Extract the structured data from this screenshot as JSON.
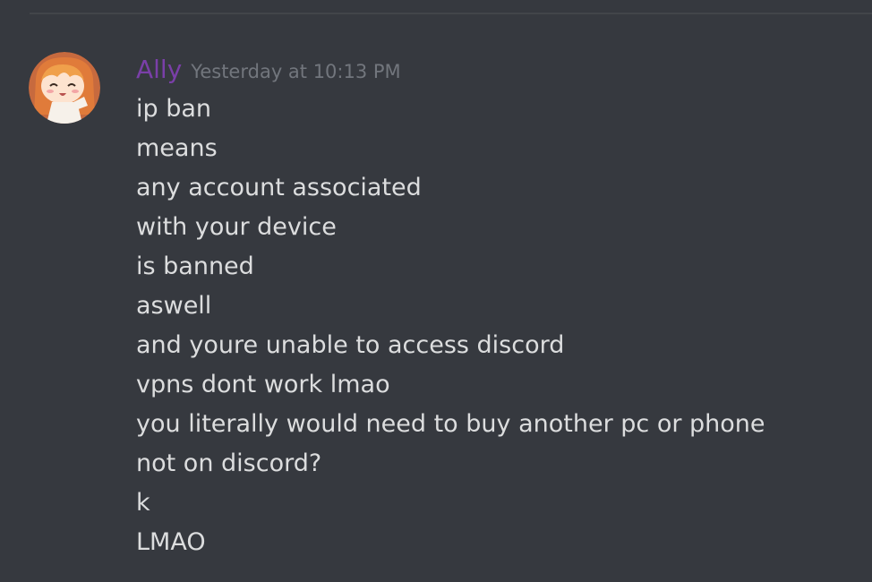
{
  "message": {
    "username": "Ally",
    "username_color": "#7a3fa8",
    "timestamp": "Yesterday at 10:13 PM",
    "avatar_icon": "anime-girl-avatar",
    "lines": [
      "ip ban",
      "means",
      "any account associated",
      "with your device",
      "is banned",
      "aswell",
      "and youre unable to access discord",
      "vpns dont work lmao",
      "you literally would need to buy another pc or phone",
      "not on discord?",
      "k",
      "LMAO"
    ]
  },
  "colors": {
    "background": "#36393f",
    "text": "#dcddde",
    "timestamp": "#72767d",
    "divider": "#42454a"
  }
}
